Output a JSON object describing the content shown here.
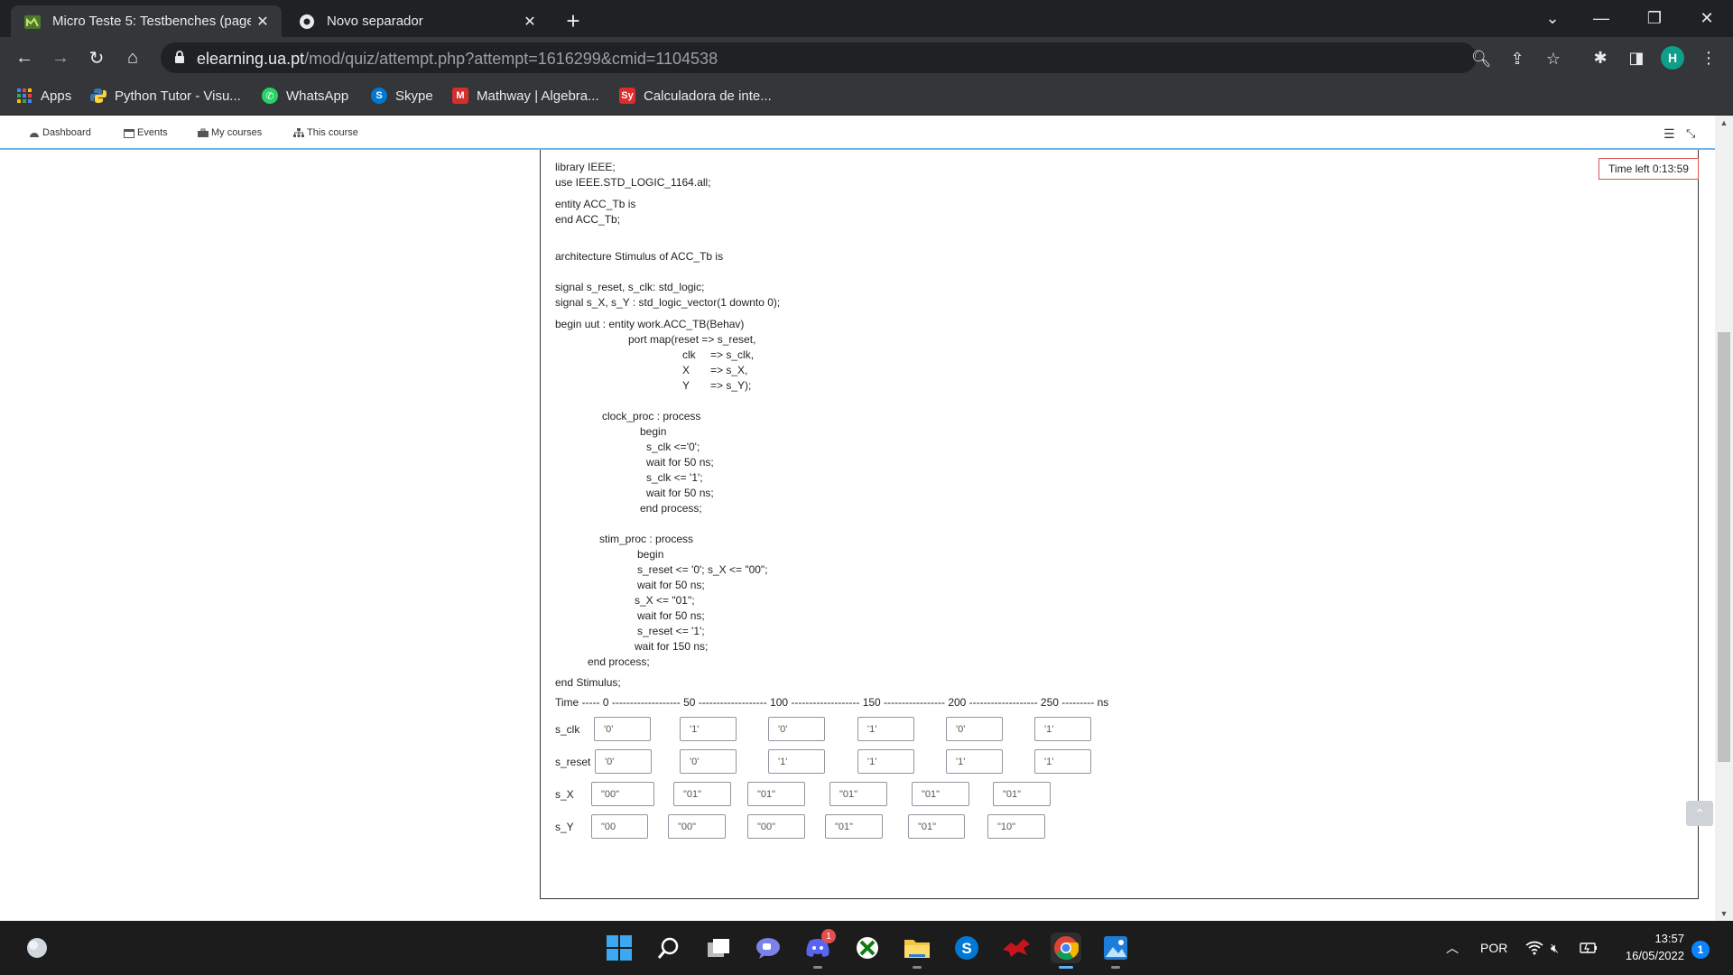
{
  "tabs": [
    {
      "title": "Micro Teste 5: Testbenches (page",
      "favicon": "moodle-icon"
    },
    {
      "title": "Novo separador",
      "favicon": "chrome-icon"
    }
  ],
  "omnibox": {
    "host": "elearning.ua.pt",
    "path": "/mod/quiz/attempt.php?attempt=1616299&cmid=1104538"
  },
  "profile_initial": "H",
  "bookmarks": [
    {
      "label": "Apps",
      "icon": "apps-grid-icon"
    },
    {
      "label": "Python Tutor - Visu...",
      "icon": "python-icon"
    },
    {
      "label": "WhatsApp",
      "icon": "whatsapp-icon"
    },
    {
      "label": "Skype",
      "icon": "skype-icon"
    },
    {
      "label": "Mathway | Algebra...",
      "icon": "mathway-icon"
    },
    {
      "label": "Calculadora de inte...",
      "icon": "symbolab-icon"
    }
  ],
  "sitenav": [
    "Dashboard",
    "Events",
    "My courses",
    "This course"
  ],
  "timer": "Time left 0:13:59",
  "code_lines": [
    "library IEEE;",
    "use IEEE.STD_LOGIC_1164.all;",
    "entity ACC_Tb is",
    "end ACC_Tb;",
    "architecture Stimulus of ACC_Tb is",
    "signal s_reset, s_clk: std_logic;",
    "signal s_X, s_Y : std_logic_vector(1 downto 0);",
    "begin uut : entity work.ACC_TB(Behav)",
    "port map(reset => s_reset,",
    "clk",
    "=> s_clk,",
    "X",
    "=> s_X,",
    "Y",
    "=> s_Y);",
    "clock_proc : process",
    "begin",
    "s_clk <='0';",
    "wait for 50 ns;",
    "s_clk <= '1';",
    "wait for 50 ns;",
    "end process;",
    "stim_proc : process",
    "begin",
    "s_reset <= '0'; s_X <= \"00\";",
    "wait for 50 ns;",
    "s_X <= \"01\";",
    "wait for 50 ns;",
    "s_reset <= '1';",
    "wait for 150 ns;",
    "end process;",
    "end Stimulus;"
  ],
  "time_axis": "Time ----- 0 ------------------- 50 ------------------- 100 ------------------- 150 ----------------- 200 ------------------- 250 --------- ns",
  "waveforms": [
    {
      "signal": "s_clk",
      "values": [
        "'0'",
        "'1'",
        "'0'",
        "'1'",
        "'0'",
        "'1'"
      ]
    },
    {
      "signal": "s_reset",
      "values": [
        "'0'",
        "'0'",
        "'1'",
        "'1'",
        "'1'",
        "'1'"
      ]
    },
    {
      "signal": "s_X",
      "values": [
        "\"00\"",
        "\"01\"",
        "\"01\"",
        "\"01\"",
        "\"01\"",
        "\"01\""
      ]
    },
    {
      "signal": "s_Y",
      "values": [
        "\"00",
        "\"00\"",
        "\"00\"",
        "\"01\"",
        "\"01\"",
        "\"10\""
      ]
    }
  ],
  "taskbar": {
    "language": "POR",
    "time": "13:57",
    "date": "16/05/2022",
    "discord_badge": "1",
    "notifications": "1"
  }
}
